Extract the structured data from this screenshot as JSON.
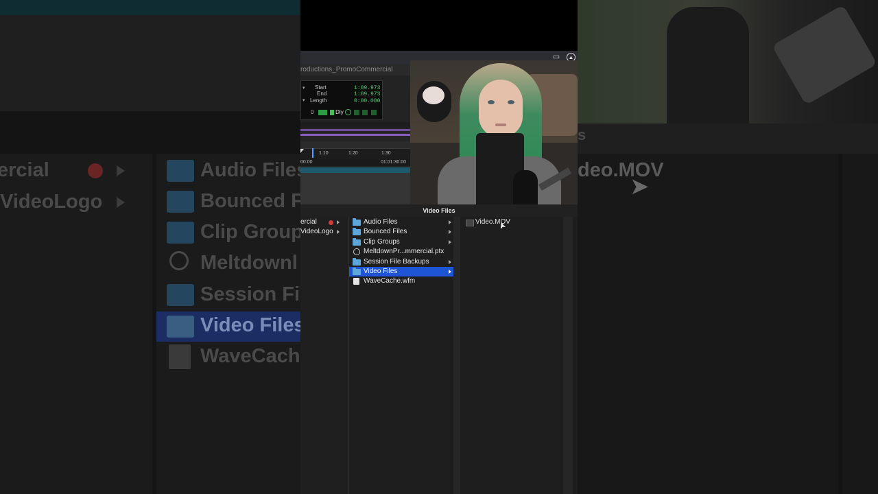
{
  "background": {
    "left_items": [
      {
        "label": "ercial",
        "badge": "record"
      },
      {
        "label": "VideoLogo"
      }
    ],
    "left_folders": [
      {
        "label": "Audio Files",
        "icon": "folder-icon"
      },
      {
        "label": "Bounced F",
        "icon": "folder-icon"
      },
      {
        "label": "Clip Group",
        "icon": "folder-icon"
      },
      {
        "label": "Meltdownl",
        "icon": "pro-tools-session-icon"
      },
      {
        "label": "Session Fi",
        "icon": "folder-icon"
      },
      {
        "label": "Video Files",
        "icon": "folder-icon",
        "selected": true
      },
      {
        "label": "WaveCach",
        "icon": "document-icon"
      }
    ],
    "right_label": "deo.MOV",
    "right_side_label": "s"
  },
  "window": {
    "session_title": "roductions_PromoCommercial",
    "icons": [
      "screen-capture-icon",
      "alert-icon"
    ]
  },
  "counter": {
    "start_label": "Start",
    "start_value": "1:09.973",
    "end_label": "End",
    "end_value": "1:09.973",
    "length_label": "Length",
    "length_value": "0:00.000",
    "row_value": "0",
    "row_mode": "Dly"
  },
  "timeline": {
    "ticks": [
      "1:10",
      "1:20",
      "1:30"
    ],
    "timecodes": [
      "00:00",
      "01:01:30:00"
    ]
  },
  "browser": {
    "title": "Video Files",
    "column1": [
      {
        "label": "ercial",
        "record": true
      },
      {
        "label": "VideoLogo"
      }
    ],
    "column2": [
      {
        "label": "Audio Files",
        "icon": "folder-icon",
        "has_children": true
      },
      {
        "label": "Bounced Files",
        "icon": "folder-icon",
        "has_children": true
      },
      {
        "label": "Clip Groups",
        "icon": "folder-icon",
        "has_children": true
      },
      {
        "label": "MeltdownPr...mmercial.ptx",
        "icon": "pro-tools-session-icon"
      },
      {
        "label": "Session File Backups",
        "icon": "folder-icon",
        "has_children": true
      },
      {
        "label": "Video Files",
        "icon": "folder-icon",
        "has_children": true,
        "selected": true
      },
      {
        "label": "WaveCache.wfm",
        "icon": "document-icon"
      }
    ],
    "column3": [
      {
        "label": "Video.MOV",
        "icon": "video-file-icon"
      }
    ]
  },
  "colors": {
    "selection": "#1e54d6",
    "folder": "#5da8da",
    "counter_green": "#47d26a",
    "record_red": "#d63a3a"
  }
}
